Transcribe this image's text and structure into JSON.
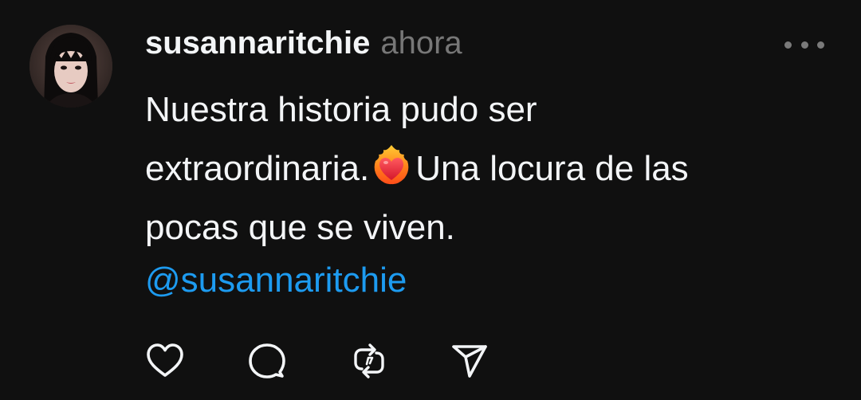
{
  "post": {
    "username": "susannaritchie",
    "timestamp": "ahora",
    "text_lines": [
      "Nuestra historia pudo ser",
      "extraordinaria.",
      "Una locura de las",
      "pocas que se viven."
    ],
    "emoji": "heart-on-fire-emoji",
    "mention": "@susannaritchie"
  },
  "icons": {
    "more": "more-options-icon",
    "like": "heart-icon",
    "comment": "comment-bubble-icon",
    "repost": "repost-icon",
    "share": "send-icon"
  },
  "colors": {
    "background": "#101010",
    "text": "#f3f5f7",
    "muted": "#777777",
    "link": "#1d9bf0"
  }
}
